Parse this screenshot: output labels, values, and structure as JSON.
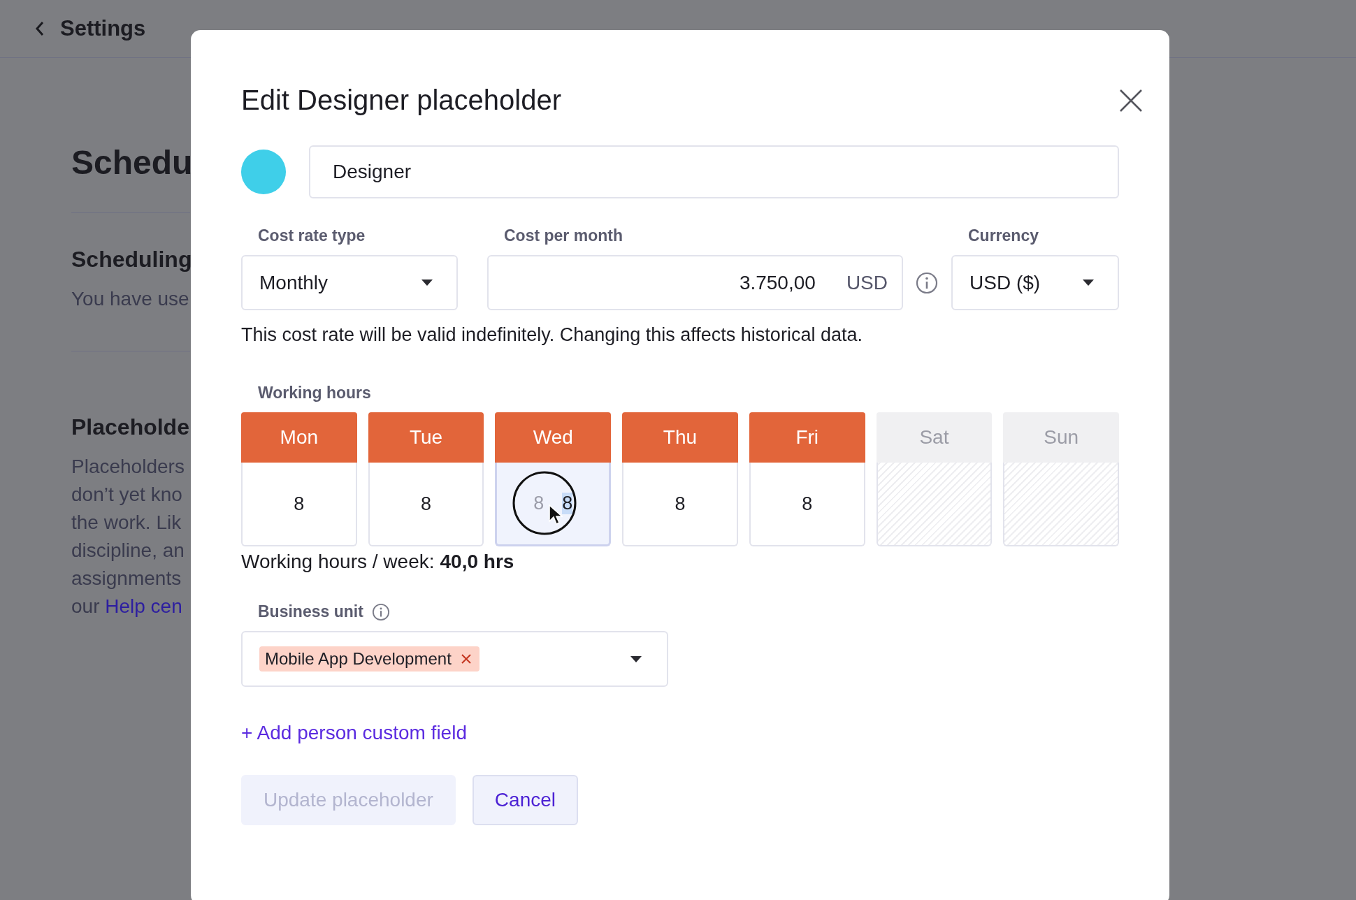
{
  "background": {
    "back_label": "Settings",
    "heading": "Schedu",
    "sections": [
      {
        "title": "Scheduling",
        "lines": [
          "You have use"
        ]
      },
      {
        "title": "Placeholde",
        "lines": [
          "Placeholders",
          "don’t yet kno",
          "the work. Lik",
          "discipline, an",
          "assignments"
        ],
        "link_prefix": "our",
        "link": "Help cen"
      }
    ]
  },
  "dialog": {
    "title": "Edit Designer placeholder",
    "color": "#3fcfe9",
    "name": "Designer",
    "cost_rate_type": {
      "label": "Cost rate type",
      "value": "Monthly"
    },
    "cost_per_month": {
      "label": "Cost per month",
      "value": "3.750,00",
      "unit": "USD"
    },
    "currency": {
      "label": "Currency",
      "value": "USD ($)"
    },
    "note": "This cost rate will be valid indefinitely. Changing this affects historical data.",
    "working_hours": {
      "label": "Working hours",
      "days": [
        {
          "label": "Mon",
          "hours": "8",
          "enabled": true,
          "selected": false
        },
        {
          "label": "Tue",
          "hours": "8",
          "enabled": true,
          "selected": false
        },
        {
          "label": "Wed",
          "hours": "8",
          "placeholder": "8",
          "enabled": true,
          "selected": true
        },
        {
          "label": "Thu",
          "hours": "8",
          "enabled": true,
          "selected": false
        },
        {
          "label": "Fri",
          "hours": "8",
          "enabled": true,
          "selected": false
        },
        {
          "label": "Sat",
          "enabled": false,
          "selected": false
        },
        {
          "label": "Sun",
          "enabled": false,
          "selected": false
        }
      ],
      "total_label": "Working hours / week:",
      "total": "40,0 hrs"
    },
    "business_unit": {
      "label": "Business unit",
      "tags": [
        "Mobile App Development"
      ]
    },
    "add_field": "+ Add person custom field",
    "buttons": [
      {
        "label": "Update placeholder",
        "disabled": true
      },
      {
        "label": "Cancel",
        "disabled": false
      }
    ]
  }
}
